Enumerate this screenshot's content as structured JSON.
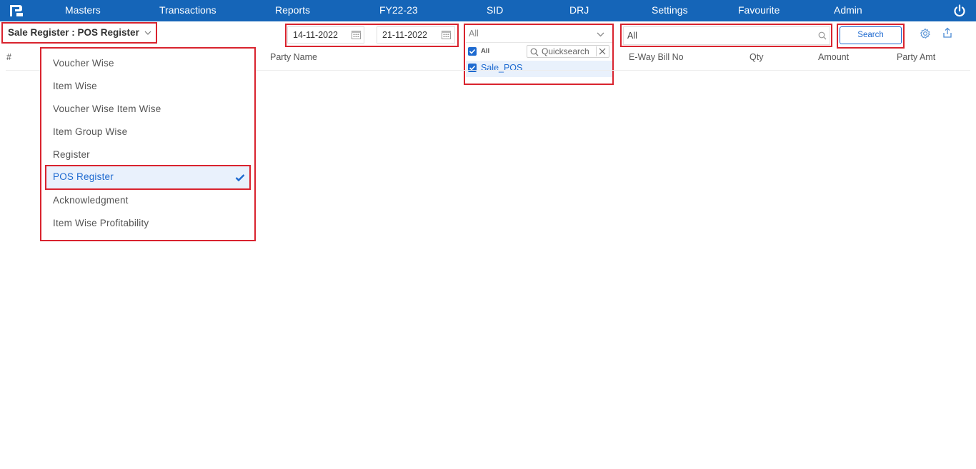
{
  "nav": {
    "items": [
      "Masters",
      "Transactions",
      "Reports",
      "FY22-23",
      "SID",
      "DRJ",
      "Settings",
      "Favourite",
      "Admin"
    ]
  },
  "toolbar": {
    "report_selector": "Sale Register : POS Register",
    "from_date": "14-11-2022",
    "to_date": "21-11-2022",
    "voucher_type": {
      "selected": "All",
      "all_label": "All",
      "quicksearch_placeholder": "Quicksearch",
      "options": [
        "Sale_POS"
      ]
    },
    "party_filter": "All",
    "search_label": "Search"
  },
  "table": {
    "headers": [
      "#",
      "Party Name",
      "E-Way Bill No",
      "Qty",
      "Amount",
      "Party Amt"
    ]
  },
  "report_menu": {
    "items": [
      "Voucher Wise",
      "Item Wise",
      "Voucher Wise Item Wise",
      "Item Group Wise",
      "Register",
      "POS Register",
      "Acknowledgment",
      "Item Wise Profitability"
    ],
    "selected": "POS Register"
  },
  "colors": {
    "topbar": "#1565b8",
    "accent": "#1e6ad0",
    "highlight": "#d9232e",
    "selected_bg": "#e9f1fc"
  }
}
